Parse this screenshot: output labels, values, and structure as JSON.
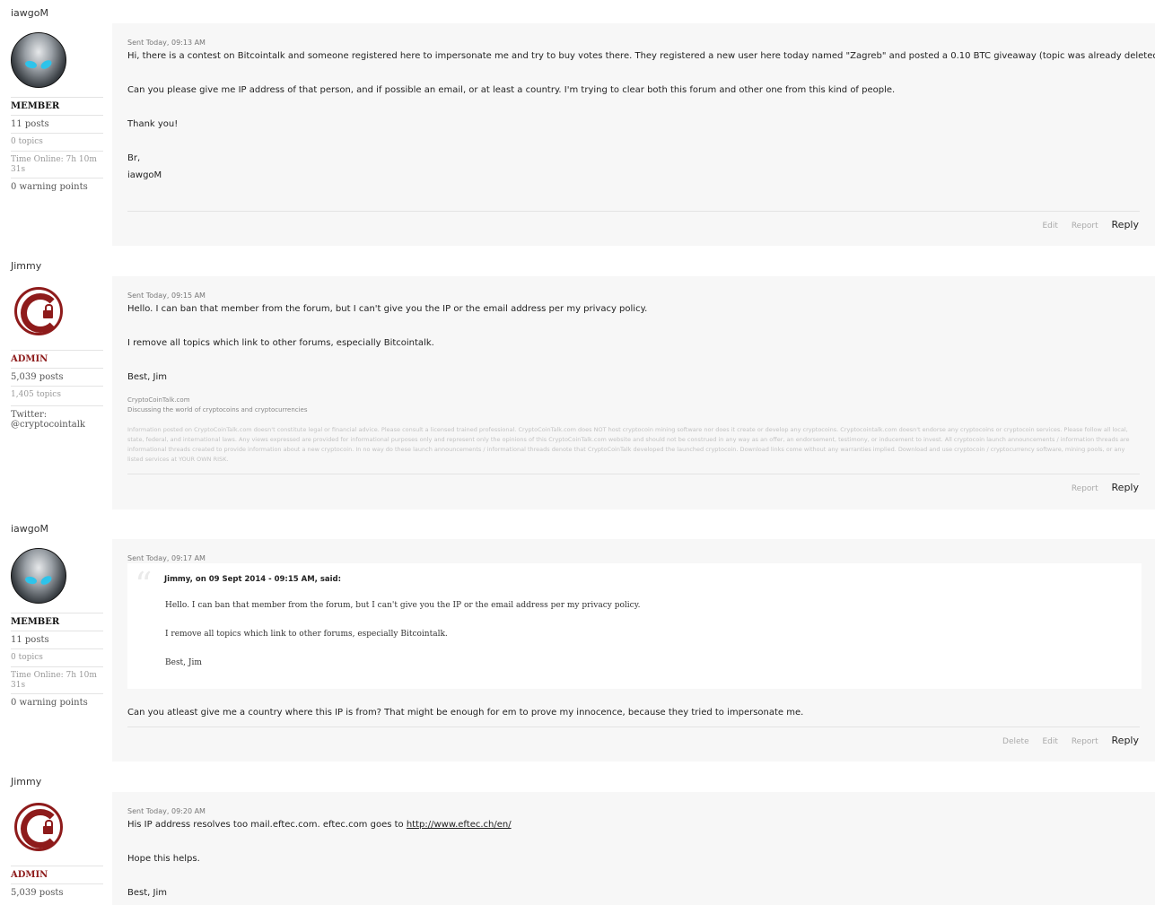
{
  "posts": [
    {
      "author": "iawgoM",
      "avatar": "alien-avatar",
      "group": "MEMBER",
      "posts": "11 posts",
      "topics": "0 topics",
      "time_online": "Time Online: 7h 10m 31s",
      "warnings": "0 warning points",
      "sent": "Sent Today, 09:13 AM",
      "lines": [
        "Hi, there is a contest on Bitcointalk and someone registered here to impersonate me and try to buy votes there. They registered a new user here today named \"Zagreb\" and posted a 0.10 BTC giveaway (topic was already deleted).",
        "Can you please give me IP address of that person, and if possible an email, or at least a country. I'm trying to clear both this forum and other one from this kind of people.",
        "Thank you!",
        "Br,",
        "iawgoM"
      ],
      "actions": [
        "Edit",
        "Report",
        "Reply"
      ]
    },
    {
      "author": "Jimmy",
      "avatar": "copyright-lock-avatar",
      "group": "ADMIN",
      "posts": "5,039 posts",
      "topics": "1,405 topics",
      "twitter": "Twitter: @cryptocointalk",
      "sent": "Sent Today, 09:15 AM",
      "lines": [
        "Hello.  I can ban that member from the forum, but I can't give you the IP or the email address per my privacy policy.",
        "I remove all topics which link to other forums, especially Bitcointalk.",
        "Best, Jim"
      ],
      "signature": {
        "site": "CryptoCoinTalk.com",
        "tagline": "Discussing the world of cryptocoins and cryptocurrencies",
        "disclaimer": "Information posted on CryptoCoinTalk.com doesn't constitute legal or financial advice.  Please consult a licensed trained professional.  CryptoCoinTalk.com does NOT host cryptocoin mining software nor does it create or develop any cryptocoins.  Cryptocointalk.com doesn't endorse any cryptocoins or cryptocoin services.  Please follow all local, state, federal, and international laws.  Any views expressed are provided for informational purposes only and represent only the opinions of this CryptoCoinTalk.com website and should not be construed in any way as an offer, an endorsement, testimony, or inducement to invest.  All cryptocoin launch announcements / information threads are informational threads created to provide information about a new cryptocoin.  In no way do these launch announcements / informational threads denote that CryptoCoinTalk developed the launched cryptocoin.  Download links come without any warranties implied.  Download and use cryptocoin / cryptocurrency software, mining pools, or any listed services at YOUR OWN RISK."
      },
      "actions": [
        "Report",
        "Reply"
      ]
    },
    {
      "author": "iawgoM",
      "avatar": "alien-avatar",
      "group": "MEMBER",
      "posts": "11 posts",
      "topics": "0 topics",
      "time_online": "Time Online: 7h 10m 31s",
      "warnings": "0 warning points",
      "sent": "Sent Today, 09:17 AM",
      "quote": {
        "header": "Jimmy, on 09 Sept 2014 - 09:15 AM, said:",
        "lines": [
          "Hello.  I can ban that member from the forum, but I can't give you the IP or the email address per my privacy policy.",
          "I remove all topics which link to other forums, especially Bitcointalk.",
          "Best, Jim"
        ]
      },
      "lines": [
        "Can you atleast give me a country where this IP is from? That might be enough for em to prove my innocence, because they tried to impersonate me."
      ],
      "actions": [
        "Delete",
        "Edit",
        "Report",
        "Reply"
      ]
    },
    {
      "author": "Jimmy",
      "avatar": "copyright-lock-avatar",
      "group": "ADMIN",
      "posts": "5,039 posts",
      "sent": "Sent Today, 09:20 AM",
      "line1_prefix": "His IP address resolves too mail.eftec.com.  eftec.com goes to ",
      "line1_link": "http://www.eftec.ch/en/",
      "lines": [
        "Hope this helps.",
        "Best, Jim"
      ]
    }
  ]
}
